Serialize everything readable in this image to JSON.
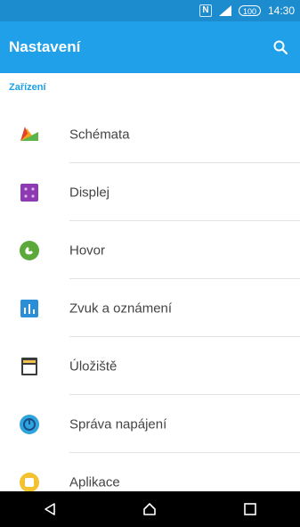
{
  "status_bar": {
    "nfc": "N",
    "signal": "LTE",
    "battery": "100",
    "time": "14:30"
  },
  "app_bar": {
    "title": "Nastavení",
    "search_icon": "search-icon"
  },
  "section": {
    "header": "Zařízení"
  },
  "items": [
    {
      "label": "Schémata",
      "icon": "themes-icon"
    },
    {
      "label": "Displej",
      "icon": "display-icon"
    },
    {
      "label": "Hovor",
      "icon": "call-icon"
    },
    {
      "label": "Zvuk a oznámení",
      "icon": "sound-icon"
    },
    {
      "label": "Úložiště",
      "icon": "storage-icon"
    },
    {
      "label": "Správa napájení",
      "icon": "power-icon"
    },
    {
      "label": "Aplikace",
      "icon": "apps-icon"
    }
  ],
  "nav_bar": {
    "back": "back-icon",
    "home": "home-icon",
    "recents": "recents-icon"
  },
  "colors": {
    "status_bar": "#1d8ccf",
    "app_bar": "#20a0e8",
    "accent": "#1da0e5"
  }
}
